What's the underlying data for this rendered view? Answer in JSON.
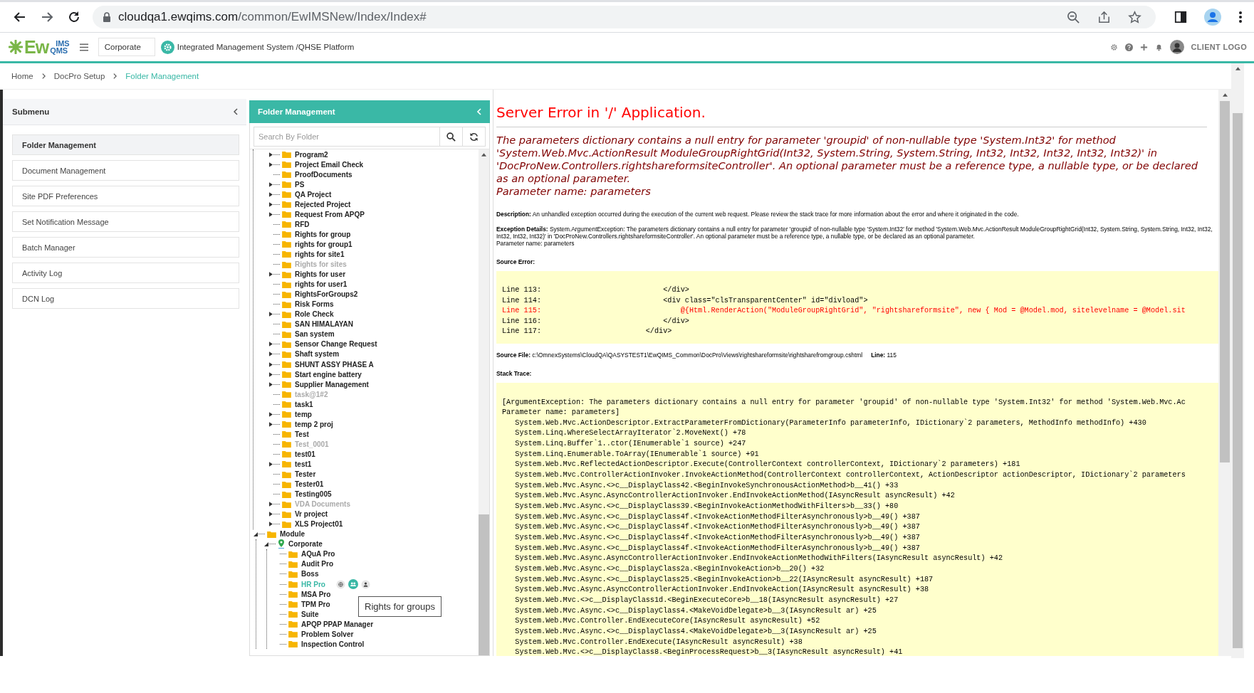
{
  "browser": {
    "url_domain": "cloudqa1.ewqims.com",
    "url_path": "/common/EwIMSNew/Index/Index#"
  },
  "header": {
    "logo": {
      "main": "Ew",
      "top": "IMS",
      "bottom": "QMS"
    },
    "site_select": "Corporate",
    "title": "Integrated Management System /QHSE Platform",
    "client_logo": "CLIENT LOGO"
  },
  "breadcrumb": [
    {
      "label": "Home",
      "current": false
    },
    {
      "label": "DocPro Setup",
      "current": false
    },
    {
      "label": "Folder Management",
      "current": true
    }
  ],
  "submenu": {
    "title": "Submenu",
    "items": [
      {
        "label": "Folder Management",
        "selected": true
      },
      {
        "label": "Document Management",
        "selected": false
      },
      {
        "label": "Site PDF Preferences",
        "selected": false
      },
      {
        "label": "Set Notification Message",
        "selected": false
      },
      {
        "label": "Batch Manager",
        "selected": false
      },
      {
        "label": "Activity Log",
        "selected": false
      },
      {
        "label": "DCN Log",
        "selected": false
      }
    ]
  },
  "folder_panel": {
    "title": "Folder Management",
    "search": {
      "placeholder": "Search By Folder"
    },
    "tooltip": "Rights for groups",
    "tree": [
      {
        "children": [
          {
            "label": "Program2",
            "kind": "folder",
            "has_children": true,
            "expanded": false,
            "disabled": false,
            "selected": false
          },
          {
            "label": "Project Email Check",
            "kind": "folder",
            "has_children": true,
            "expanded": false,
            "disabled": false,
            "selected": false
          },
          {
            "label": "ProofDocuments",
            "kind": "folder",
            "has_children": false,
            "expanded": false,
            "disabled": false,
            "selected": false
          },
          {
            "label": "PS",
            "kind": "folder",
            "has_children": true,
            "expanded": false,
            "disabled": false,
            "selected": false
          },
          {
            "label": "QA Project",
            "kind": "folder",
            "has_children": true,
            "expanded": false,
            "disabled": false,
            "selected": false
          },
          {
            "label": "Rejected Project",
            "kind": "folder",
            "has_children": true,
            "expanded": false,
            "disabled": false,
            "selected": false
          },
          {
            "label": "Request From APQP",
            "kind": "folder",
            "has_children": true,
            "expanded": false,
            "disabled": false,
            "selected": false
          },
          {
            "label": "RFD",
            "kind": "folder",
            "has_children": false,
            "expanded": false,
            "disabled": false,
            "selected": false
          },
          {
            "label": "Rights for group",
            "kind": "folder",
            "has_children": false,
            "expanded": false,
            "disabled": false,
            "selected": false
          },
          {
            "label": "rights for group1",
            "kind": "folder",
            "has_children": false,
            "expanded": false,
            "disabled": false,
            "selected": false
          },
          {
            "label": "rights for site1",
            "kind": "folder",
            "has_children": false,
            "expanded": false,
            "disabled": false,
            "selected": false
          },
          {
            "label": "Rights for sites",
            "kind": "folder",
            "has_children": false,
            "expanded": false,
            "disabled": true,
            "selected": false
          },
          {
            "label": "Rights for user",
            "kind": "folder",
            "has_children": true,
            "expanded": false,
            "disabled": false,
            "selected": false
          },
          {
            "label": "rights for user1",
            "kind": "folder",
            "has_children": false,
            "expanded": false,
            "disabled": false,
            "selected": false
          },
          {
            "label": "RightsForGroups2",
            "kind": "folder",
            "has_children": false,
            "expanded": false,
            "disabled": false,
            "selected": false
          },
          {
            "label": "Risk Forms",
            "kind": "folder",
            "has_children": false,
            "expanded": false,
            "disabled": false,
            "selected": false
          },
          {
            "label": "Role Check",
            "kind": "folder",
            "has_children": true,
            "expanded": false,
            "disabled": false,
            "selected": false
          },
          {
            "label": "SAN HIMALAYAN",
            "kind": "folder",
            "has_children": false,
            "expanded": false,
            "disabled": false,
            "selected": false
          },
          {
            "label": "San system",
            "kind": "folder",
            "has_children": false,
            "expanded": false,
            "disabled": false,
            "selected": false
          },
          {
            "label": "Sensor Change Request",
            "kind": "folder",
            "has_children": true,
            "expanded": false,
            "disabled": false,
            "selected": false
          },
          {
            "label": "Shaft system",
            "kind": "folder",
            "has_children": true,
            "expanded": false,
            "disabled": false,
            "selected": false
          },
          {
            "label": "SHUNT ASSY PHASE A",
            "kind": "folder",
            "has_children": true,
            "expanded": false,
            "disabled": false,
            "selected": false
          },
          {
            "label": "Start engine battery",
            "kind": "folder",
            "has_children": true,
            "expanded": false,
            "disabled": false,
            "selected": false
          },
          {
            "label": "Supplier Management",
            "kind": "folder",
            "has_children": true,
            "expanded": false,
            "disabled": false,
            "selected": false
          },
          {
            "label": "task@1#2",
            "kind": "folder",
            "has_children": false,
            "expanded": false,
            "disabled": true,
            "selected": false
          },
          {
            "label": "task1",
            "kind": "folder",
            "has_children": false,
            "expanded": false,
            "disabled": false,
            "selected": false
          },
          {
            "label": "temp",
            "kind": "folder",
            "has_children": true,
            "expanded": false,
            "disabled": false,
            "selected": false
          },
          {
            "label": "temp 2 proj",
            "kind": "folder",
            "has_children": true,
            "expanded": false,
            "disabled": false,
            "selected": false
          },
          {
            "label": "Test",
            "kind": "folder",
            "has_children": false,
            "expanded": false,
            "disabled": false,
            "selected": false
          },
          {
            "label": "Test_0001",
            "kind": "folder",
            "has_children": false,
            "expanded": false,
            "disabled": true,
            "selected": false
          },
          {
            "label": "test01",
            "kind": "folder",
            "has_children": false,
            "expanded": false,
            "disabled": false,
            "selected": false
          },
          {
            "label": "test1",
            "kind": "folder",
            "has_children": true,
            "expanded": false,
            "disabled": false,
            "selected": false
          },
          {
            "label": "Tester",
            "kind": "folder",
            "has_children": false,
            "expanded": false,
            "disabled": false,
            "selected": false
          },
          {
            "label": "Tester01",
            "kind": "folder",
            "has_children": false,
            "expanded": false,
            "disabled": false,
            "selected": false
          },
          {
            "label": "Testing005",
            "kind": "folder",
            "has_children": false,
            "expanded": false,
            "disabled": false,
            "selected": false
          },
          {
            "label": "VDA Documents",
            "kind": "folder",
            "has_children": true,
            "expanded": false,
            "disabled": true,
            "selected": false
          },
          {
            "label": "Vr project",
            "kind": "folder",
            "has_children": true,
            "expanded": false,
            "disabled": false,
            "selected": false
          },
          {
            "label": "XLS Project01",
            "kind": "folder",
            "has_children": true,
            "expanded": false,
            "disabled": false,
            "selected": false
          }
        ]
      },
      {
        "label": "Module",
        "kind": "folder",
        "expanded": true,
        "disabled": false,
        "selected": false,
        "children": [
          {
            "label": "Corporate",
            "kind": "location",
            "expanded": true,
            "disabled": false,
            "selected": false,
            "children": [
              {
                "label": "AQuA Pro",
                "kind": "folder",
                "has_children": false,
                "expanded": false,
                "disabled": false,
                "selected": false
              },
              {
                "label": "Audit Pro",
                "kind": "folder",
                "has_children": false,
                "expanded": false,
                "disabled": false,
                "selected": false
              },
              {
                "label": "Boss",
                "kind": "folder",
                "has_children": false,
                "expanded": false,
                "disabled": false,
                "selected": false
              },
              {
                "label": "HR Pro",
                "kind": "folder",
                "has_children": false,
                "expanded": false,
                "disabled": false,
                "selected": true
              },
              {
                "label": "MSA Pro",
                "kind": "folder",
                "has_children": false,
                "expanded": false,
                "disabled": false,
                "selected": false
              },
              {
                "label": "TPM Pro",
                "kind": "folder",
                "has_children": false,
                "expanded": false,
                "disabled": false,
                "selected": false
              },
              {
                "label": "Suite",
                "kind": "folder",
                "has_children": false,
                "expanded": false,
                "disabled": false,
                "selected": false
              },
              {
                "label": "APQP PPAP Manager",
                "kind": "folder",
                "has_children": false,
                "expanded": false,
                "disabled": false,
                "selected": false
              },
              {
                "label": "Problem Solver",
                "kind": "folder",
                "has_children": false,
                "expanded": false,
                "disabled": false,
                "selected": false
              },
              {
                "label": "Inspection Control",
                "kind": "folder",
                "has_children": false,
                "expanded": false,
                "disabled": false,
                "selected": false
              }
            ]
          }
        ]
      }
    ]
  },
  "error": {
    "title": "Server Error in '/' Application.",
    "message": "The parameters dictionary contains a null entry for parameter 'groupid' of non-nullable type 'System.Int32' for method 'System.Web.Mvc.ActionResult ModuleGroupRightGrid(Int32, System.String, System.String, Int32, Int32, Int32, Int32, Int32)' in 'DocProNew.Controllers.rightshareformsiteController'. An optional parameter must be a reference type, a nullable type, or be declared as an optional parameter.",
    "message_param": "Parameter name: parameters",
    "description": "**Description:** An unhandled exception occurred during the execution of the current web request. Please review the stack trace for more information about the error and where it originated in the code.",
    "exception": "**Exception Details:** System.ArgumentException: The parameters dictionary contains a null entry for parameter 'groupid' of non-nullable type 'System.Int32' for method 'System.Web.Mvc.ActionResult ModuleGroupRightGrid(Int32, System.String, System.String, Int32, Int32, Int32, Int32, Int32)' in 'DocProNew.Controllers.rightshareformsiteController'. An optional parameter must be a reference type, a nullable type, or be declared as an optional parameter.",
    "exception_param": "Parameter name: parameters",
    "source_error_label": "Source Error:",
    "source_lines": [
      {
        "text": "Line 113:                            </div>",
        "highlighted": false
      },
      {
        "text": "Line 114:                            <div class=\"clsTransparentCenter\" id=\"divload\">",
        "highlighted": false
      },
      {
        "text": "Line 115:                                @{Html.RenderAction(\"ModuleGroupRightGrid\", \"rightshareformsite\", new { Mod = @Model.mod, sitelevelname = @Model.sit",
        "highlighted": true
      },
      {
        "text": "Line 116:                            </div>",
        "highlighted": false
      },
      {
        "text": "Line 117:                        </div>",
        "highlighted": false
      }
    ],
    "source_file": "**Source File:** c:\\OmnexSystems\\CloudQA\\QASYSTEST1\\EwQIMS_Common\\DocPro\\Views\\rightshareformsite\\rightsharefromgroup.cshtml",
    "source_line": "**Line:** 115",
    "stack_trace_label": "Stack Trace:",
    "stack_trace": [
      "[ArgumentException: The parameters dictionary contains a null entry for parameter 'groupid' of non-nullable type 'System.Int32' for method 'System.Web.Mvc.Ac",
      "Parameter name: parameters]",
      "   System.Web.Mvc.ActionDescriptor.ExtractParameterFromDictionary(ParameterInfo parameterInfo, IDictionary`2 parameters, MethodInfo methodInfo) +430",
      "   System.Linq.WhereSelectArrayIterator`2.MoveNext() +78",
      "   System.Linq.Buffer`1..ctor(IEnumerable`1 source) +247",
      "   System.Linq.Enumerable.ToArray(IEnumerable`1 source) +91",
      "   System.Web.Mvc.ReflectedActionDescriptor.Execute(ControllerContext controllerContext, IDictionary`2 parameters) +181",
      "   System.Web.Mvc.ControllerActionInvoker.InvokeActionMethod(ControllerContext controllerContext, ActionDescriptor actionDescriptor, IDictionary`2 parameters",
      "   System.Web.Mvc.Async.<>c__DisplayClass42.<BeginInvokeSynchronousActionMethod>b__41() +33",
      "   System.Web.Mvc.Async.AsyncControllerActionInvoker.EndInvokeActionMethod(IAsyncResult asyncResult) +42",
      "   System.Web.Mvc.Async.<>c__DisplayClass39.<BeginInvokeActionMethodWithFilters>b__33() +80",
      "   System.Web.Mvc.Async.<>c__DisplayClass4f.<InvokeActionMethodFilterAsynchronously>b__49() +387",
      "   System.Web.Mvc.Async.<>c__DisplayClass4f.<InvokeActionMethodFilterAsynchronously>b__49() +387",
      "   System.Web.Mvc.Async.<>c__DisplayClass4f.<InvokeActionMethodFilterAsynchronously>b__49() +387",
      "   System.Web.Mvc.Async.<>c__DisplayClass4f.<InvokeActionMethodFilterAsynchronously>b__49() +387",
      "   System.Web.Mvc.Async.AsyncControllerActionInvoker.EndInvokeActionMethodWithFilters(IAsyncResult asyncResult) +42",
      "   System.Web.Mvc.Async.<>c__DisplayClass2a.<BeginInvokeAction>b__20() +32",
      "   System.Web.Mvc.Async.<>c__DisplayClass25.<BeginInvokeAction>b__22(IAsyncResult asyncResult) +187",
      "   System.Web.Mvc.Async.AsyncControllerActionInvoker.EndInvokeAction(IAsyncResult asyncResult) +38",
      "   System.Web.Mvc.<>c__DisplayClass1d.<BeginExecuteCore>b__18(IAsyncResult asyncResult) +27",
      "   System.Web.Mvc.Async.<>c__DisplayClass4.<MakeVoidDelegate>b__3(IAsyncResult ar) +25",
      "   System.Web.Mvc.Controller.EndExecuteCore(IAsyncResult asyncResult) +52",
      "   System.Web.Mvc.Async.<>c__DisplayClass4.<MakeVoidDelegate>b__3(IAsyncResult ar) +25",
      "   System.Web.Mvc.Controller.EndExecute(IAsyncResult asyncResult) +38",
      "   System.Web.Mvc.<>c__DisplayClass8.<BeginProcessRequest>b__3(IAsyncResult asyncResult) +41"
    ]
  }
}
